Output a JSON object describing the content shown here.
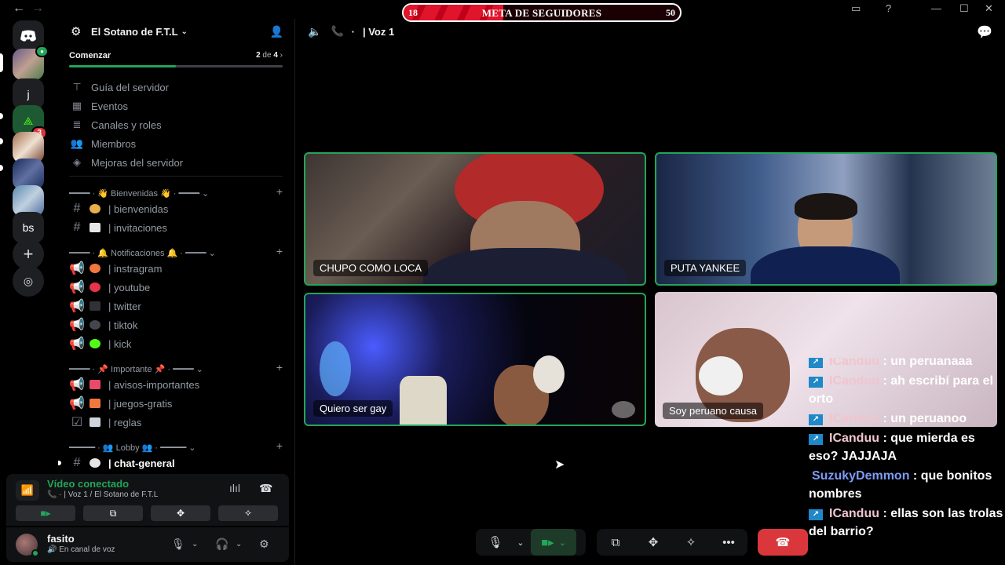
{
  "titlebar": {
    "goal": {
      "left": "18",
      "title": "META DE SEGUIDORES",
      "right": "50",
      "progress": 0.36
    }
  },
  "rail": {
    "items": [
      {
        "name": "direct-messages",
        "label": ""
      },
      {
        "name": "server-1",
        "label": ""
      },
      {
        "name": "server-j",
        "label": "j"
      },
      {
        "name": "server-3",
        "label": "",
        "badge": "3"
      },
      {
        "name": "server-4",
        "label": ""
      },
      {
        "name": "server-5",
        "label": ""
      },
      {
        "name": "server-6",
        "label": ""
      },
      {
        "name": "server-bs",
        "label": "bs"
      }
    ]
  },
  "guild": {
    "name": "El Sotano de F.T.L",
    "start": {
      "label": "Comenzar",
      "done": "2",
      "of": "de",
      "total": "4",
      "progress": 0.5
    },
    "menu": [
      {
        "label": "Guía del servidor",
        "icon": "signpost-icon"
      },
      {
        "label": "Eventos",
        "icon": "calendar-icon"
      },
      {
        "label": "Canales y roles",
        "icon": "channels-icon"
      },
      {
        "label": "Miembros",
        "icon": "members-icon"
      },
      {
        "label": "Mejoras del servidor",
        "icon": "boost-icon"
      }
    ],
    "categories": [
      {
        "label": "━━━━ · 👋 Bienvenidas 👋 · ━━━━ ⌄"
      },
      {
        "label": "━━━━ · 🔔 Notificaciones 🔔 · ━━━━ ⌄"
      },
      {
        "label": "━━━━ · 📌 Importante 📌 · ━━━━ ⌄"
      },
      {
        "label": "━━━━━ · 👥 Lobby 👥 · ━━━━━ ⌄"
      }
    ],
    "channels": [
      {
        "name": "bienvenidas",
        "label": "| bienvenidas",
        "emo": "#e8b04a"
      },
      {
        "name": "invitaciones",
        "label": "| invitaciones",
        "emo": "#e6e6e6"
      },
      {
        "name": "instragram",
        "label": "| instragram",
        "emo": "#f0783c"
      },
      {
        "name": "youtube",
        "label": "| youtube",
        "emo": "#e8344a"
      },
      {
        "name": "twitter",
        "label": "| twitter",
        "emo": "#303236"
      },
      {
        "name": "tiktok",
        "label": "| tiktok",
        "emo": "#44464c"
      },
      {
        "name": "kick",
        "label": "| kick",
        "emo": "#53fc18"
      },
      {
        "name": "avisos-importantes",
        "label": "| avisos-importantes",
        "emo": "#e84a6a"
      },
      {
        "name": "juegos-gratis",
        "label": "| juegos-gratis",
        "emo": "#f0783c"
      },
      {
        "name": "reglas",
        "label": "| reglas",
        "emo": "#d0d4dc"
      },
      {
        "name": "chat-general",
        "label": "| chat-general",
        "emo": "#e6e6e6"
      }
    ]
  },
  "voice_panel": {
    "title": "Vídeo conectado",
    "sub": "Voz 1 / El Sotano de F.T.L"
  },
  "user": {
    "name": "fasito",
    "status": "En canal de voz"
  },
  "voice_header": {
    "dot": "·",
    "channel": "| Voz 1"
  },
  "tiles": [
    {
      "label": "CHUPO COMO LOCA"
    },
    {
      "label": "PUTA YANKEE"
    },
    {
      "label": "Quiero ser gay"
    },
    {
      "label": "Soy peruano causa"
    }
  ],
  "chat_overlay": [
    {
      "user": "ICanduu",
      "text": ": un peruanaaa"
    },
    {
      "user": "ICanduu",
      "text": ": ah escribí para el orto"
    },
    {
      "user": "ICanduu",
      "text": ": un peruanoo"
    },
    {
      "user": "ICanduu",
      "text": ": que mierda es eso? JAJJAJA"
    },
    {
      "user": "SuzukyDemmon",
      "text": ": que bonitos nombres"
    },
    {
      "user": "ICanduu",
      "text": ": ellas son las trolas del barrio?"
    }
  ],
  "colors": {
    "green": "#23a55a",
    "red": "#da373c",
    "accent": "#5865f2"
  }
}
